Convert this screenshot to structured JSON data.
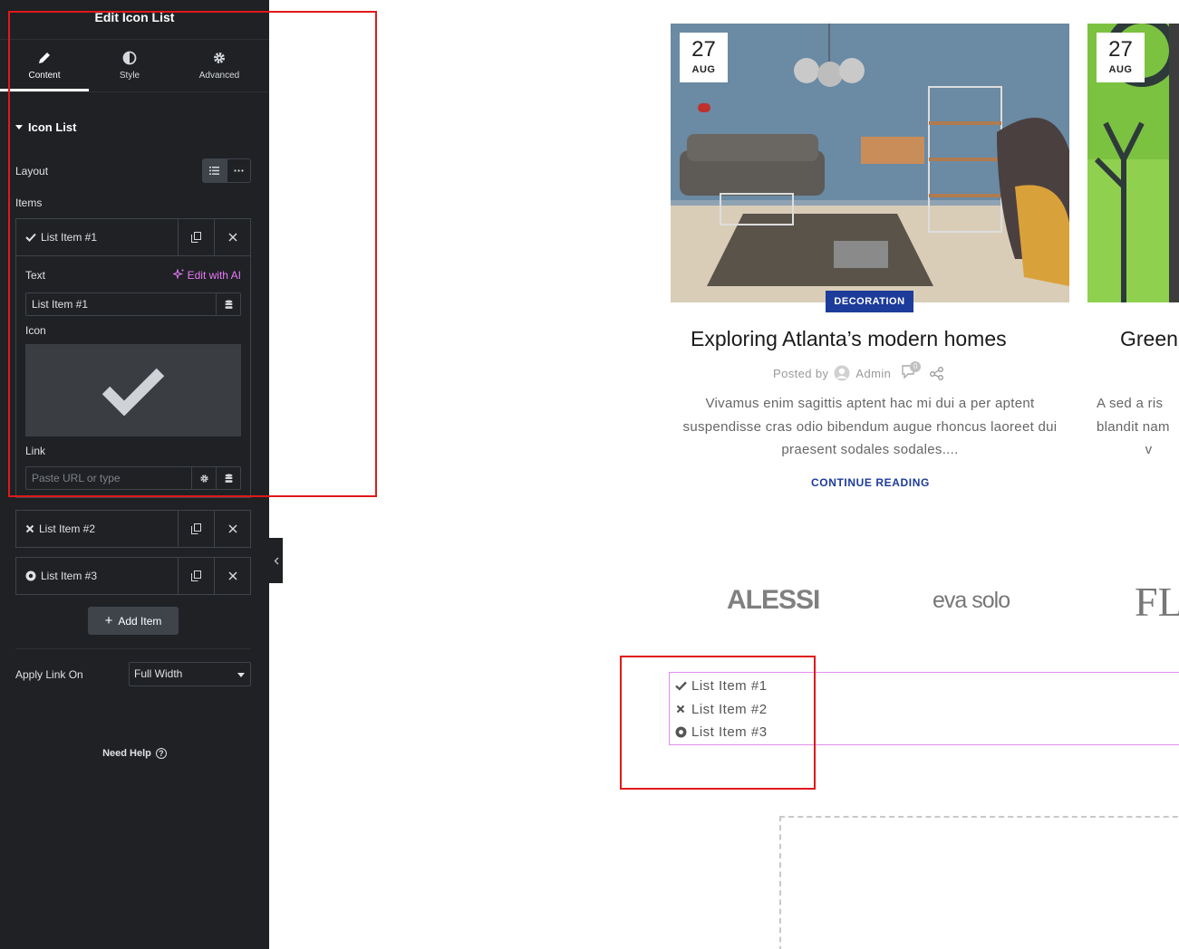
{
  "panel": {
    "title": "Edit Icon List",
    "tabs": [
      {
        "label": "Content",
        "icon": "pencil-icon",
        "active": true
      },
      {
        "label": "Style",
        "icon": "half-circle-icon",
        "active": false
      },
      {
        "label": "Advanced",
        "icon": "gear-icon",
        "active": false
      }
    ],
    "section_title": "Icon List",
    "layout_label": "Layout",
    "items_label": "Items",
    "items": [
      {
        "label": "List Item #1",
        "icon": "check-icon"
      },
      {
        "label": "List Item #2",
        "icon": "times-icon"
      },
      {
        "label": "List Item #3",
        "icon": "dot-circle-icon"
      }
    ],
    "editor": {
      "text_label": "Text",
      "ai_label": "Edit with AI",
      "text_value": "List Item #1",
      "icon_label": "Icon",
      "link_label": "Link",
      "link_placeholder": "Paste URL or type"
    },
    "add_item_label": "Add Item",
    "apply_link_label": "Apply Link On",
    "apply_link_value": "Full Width",
    "need_help": "Need Help",
    "need_help_glyph": "?"
  },
  "posts": [
    {
      "day": "27",
      "month": "AUG",
      "category": "DECORATION",
      "title": "Exploring Atlanta’s modern homes",
      "posted_by": "Posted by",
      "author": "Admin",
      "comments": "0",
      "excerpt": "Vivamus enim sagittis aptent hac mi dui a per aptent suspendisse cras odio bibendum augue rhoncus laoreet dui praesent sodales sodales....",
      "read_more": "CONTINUE READING"
    },
    {
      "day": "27",
      "month": "AUG",
      "title": "Green",
      "excerpt": "A sed a ris\nblandit nam\n            v"
    }
  ],
  "brands": [
    "ALESSI",
    "eva solo",
    "FL"
  ],
  "icon_list": [
    {
      "label": "List Item #1",
      "icon": "check-icon"
    },
    {
      "label": "List Item #2",
      "icon": "times-icon"
    },
    {
      "label": "List Item #3",
      "icon": "dot-circle-icon"
    }
  ],
  "colors": {
    "panel_bg": "#1f2124",
    "accent_blue": "#1d3b9a",
    "ai_pink": "#e879f9",
    "annotation_red": "#e11919",
    "selection_outline": "#e38cf0"
  }
}
